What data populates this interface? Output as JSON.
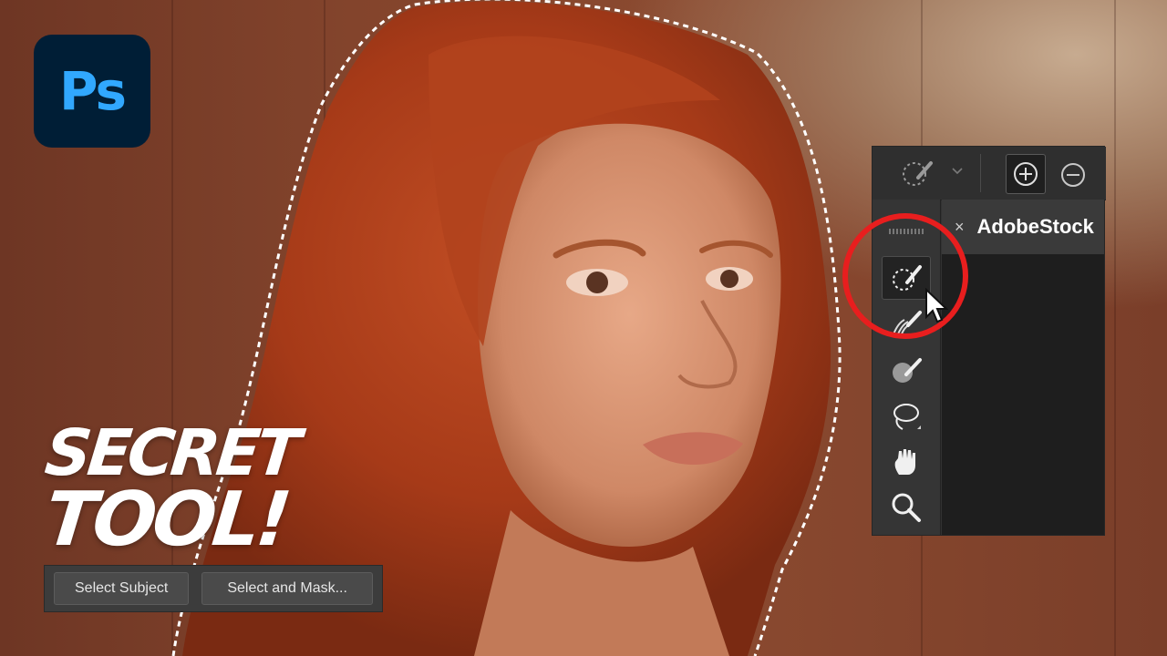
{
  "logo": {
    "text": "Ps",
    "icon": "photoshop-logo"
  },
  "headline": {
    "line1": "SECRET",
    "line2": "TOOL!"
  },
  "options_bar": {
    "select_subject_label": "Select Subject",
    "select_and_mask_label": "Select and Mask..."
  },
  "panel": {
    "document_tab": {
      "close_icon": "×",
      "title": "AdobeStock"
    },
    "top_options": {
      "tool_icon": "quick-selection-brush-icon",
      "add_icon": "add-selection-icon",
      "subtract_icon": "subtract-selection-icon"
    },
    "tools": [
      "quick-selection-brush-icon",
      "refine-edge-brush-icon",
      "brush-icon",
      "lasso-icon",
      "hand-icon",
      "zoom-icon"
    ]
  },
  "colors": {
    "ps_blue": "#31a8ff",
    "ps_dark": "#001e36",
    "highlight_red": "#e81e1e"
  }
}
